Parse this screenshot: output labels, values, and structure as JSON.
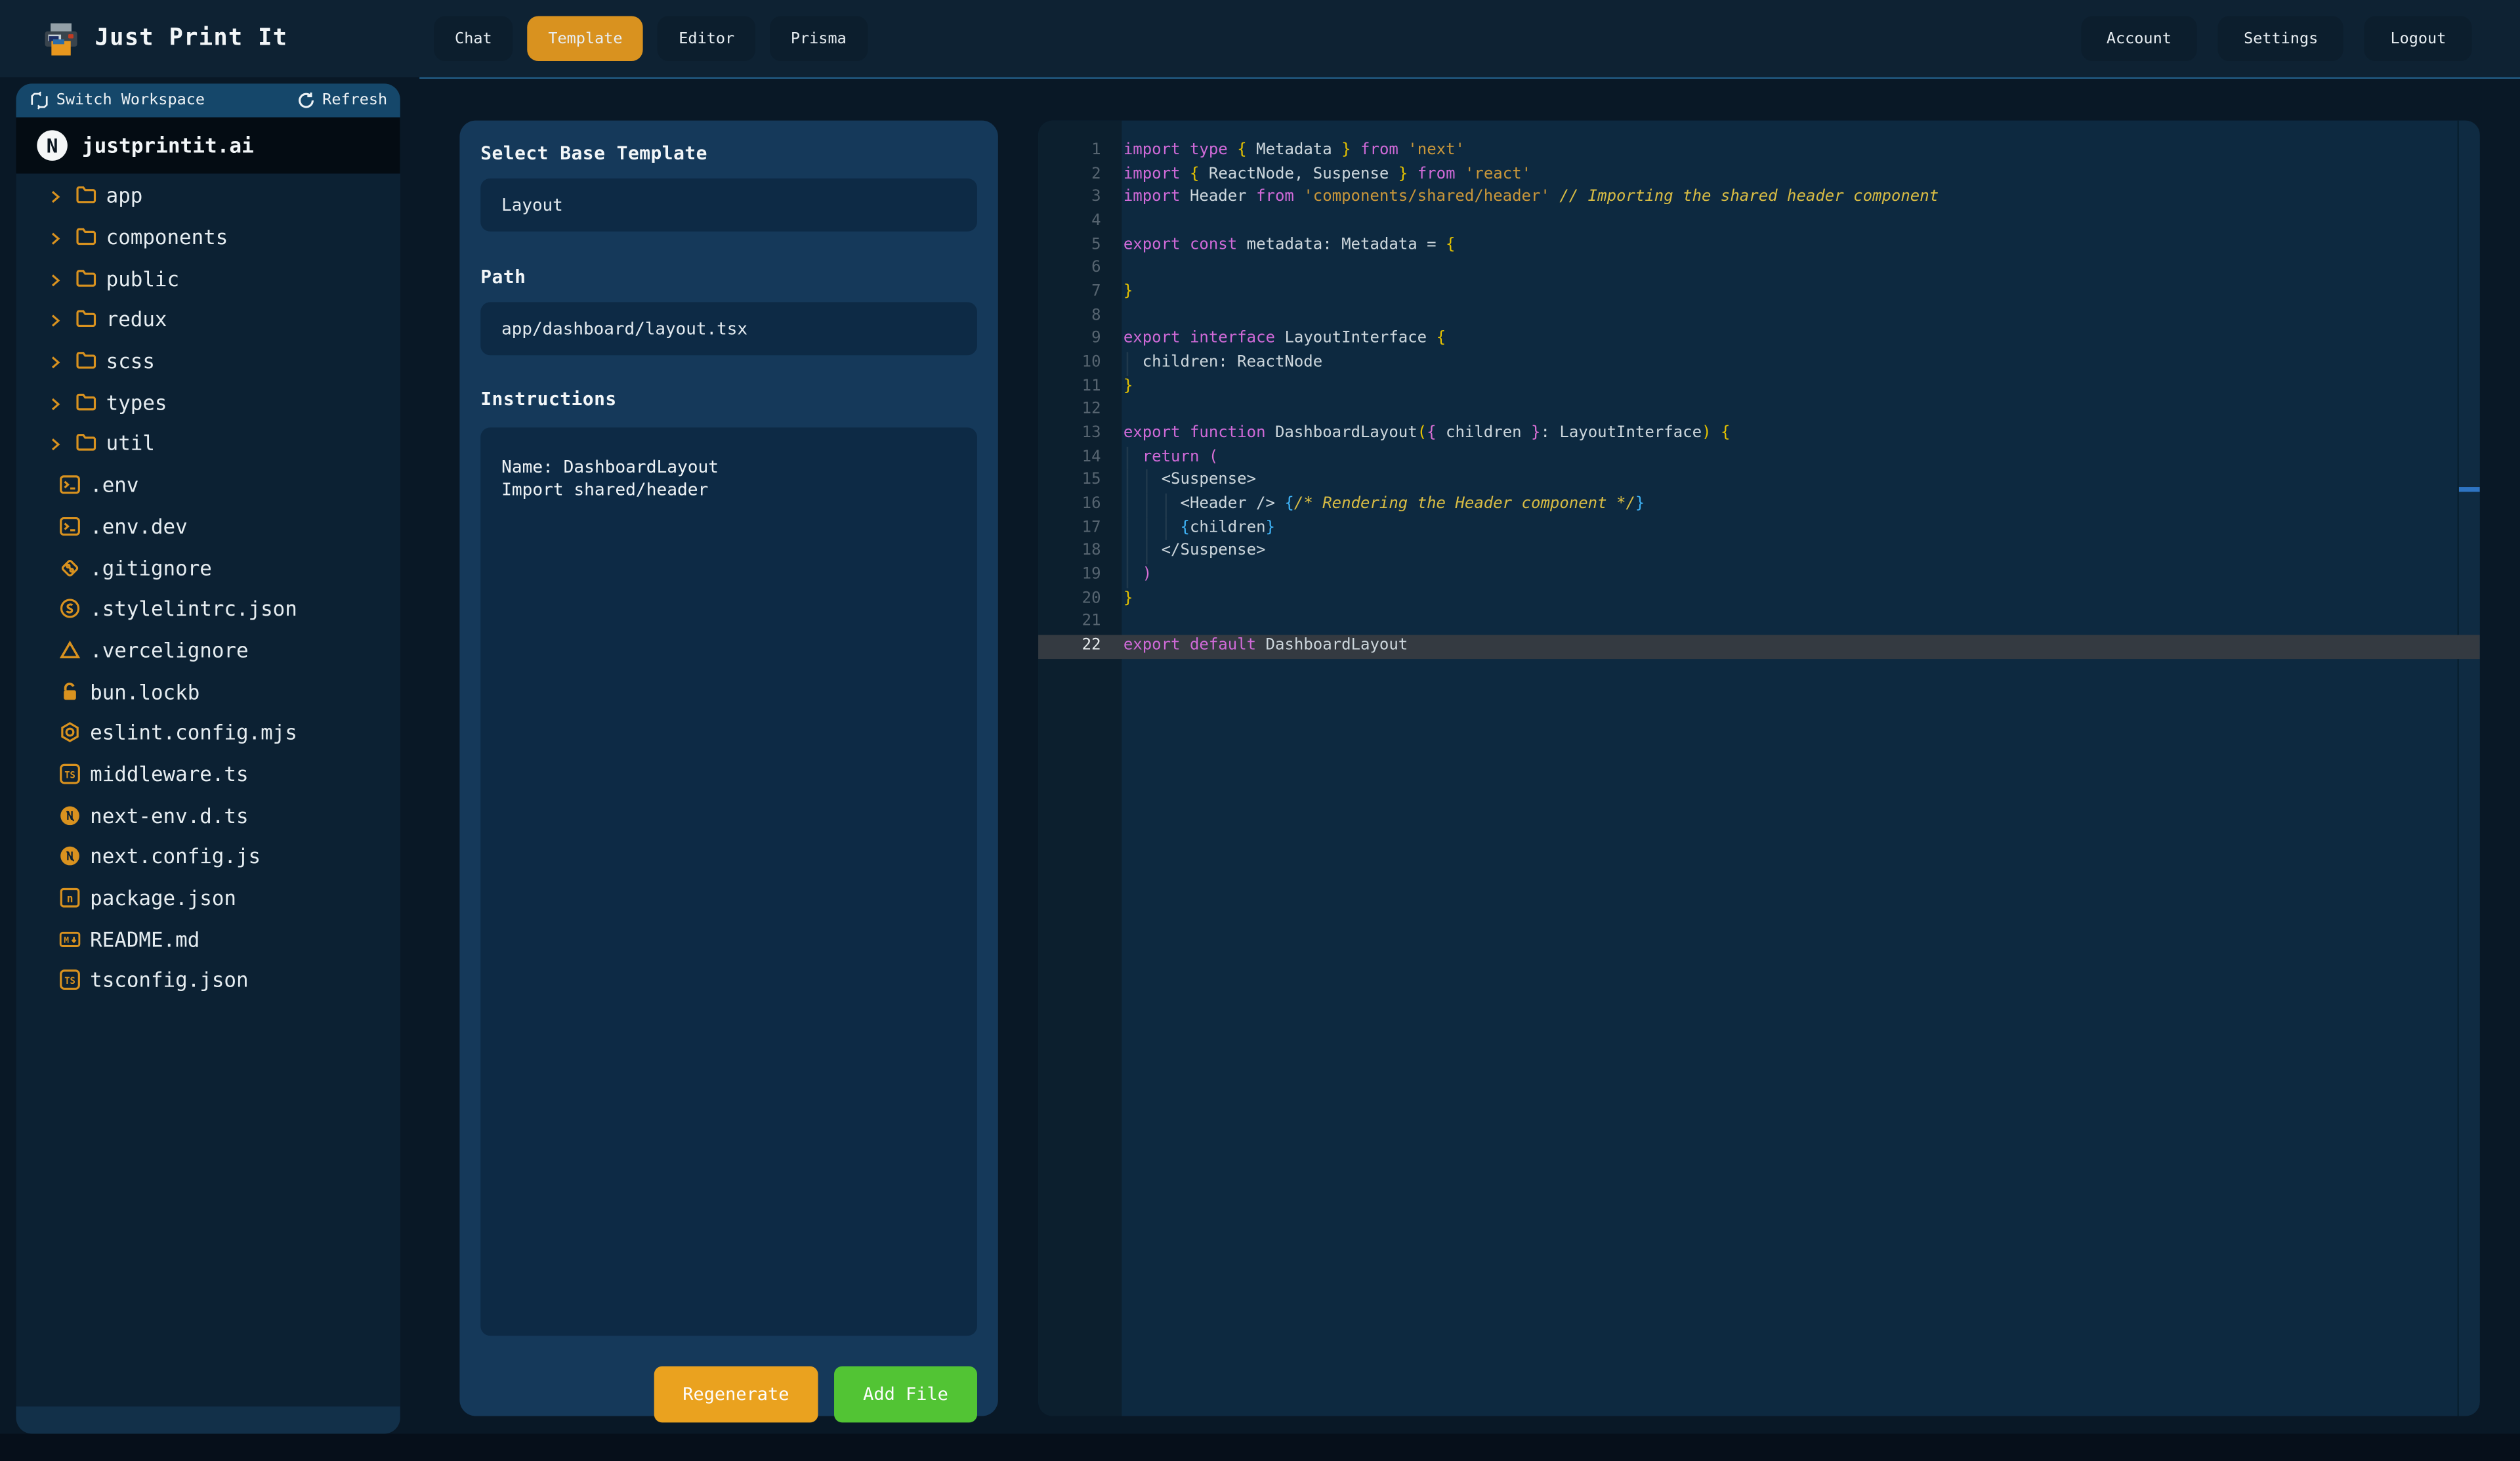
{
  "app": {
    "title": "Just Print It"
  },
  "topbar": {
    "tabs": [
      {
        "label": "Chat",
        "active": false
      },
      {
        "label": "Template",
        "active": true
      },
      {
        "label": "Editor",
        "active": false
      },
      {
        "label": "Prisma",
        "active": false
      }
    ],
    "session_buttons": [
      "Account",
      "Settings",
      "Logout"
    ]
  },
  "sidebar": {
    "switch_workspace_label": "Switch Workspace",
    "refresh_label": "Refresh",
    "workspace_name": "justprintit.ai",
    "workspace_badge": "N",
    "folders": [
      "app",
      "components",
      "public",
      "redux",
      "scss",
      "types",
      "util"
    ],
    "files": [
      {
        "name": ".env",
        "icon": "terminal"
      },
      {
        "name": ".env.dev",
        "icon": "terminal"
      },
      {
        "name": ".gitignore",
        "icon": "git"
      },
      {
        "name": ".stylelintrc.json",
        "icon": "stylelint"
      },
      {
        "name": ".vercelignore",
        "icon": "vercel"
      },
      {
        "name": "bun.lockb",
        "icon": "lock"
      },
      {
        "name": "eslint.config.mjs",
        "icon": "eslint"
      },
      {
        "name": "middleware.ts",
        "icon": "typescript"
      },
      {
        "name": "next-env.d.ts",
        "icon": "nextjs"
      },
      {
        "name": "next.config.js",
        "icon": "nextjs"
      },
      {
        "name": "package.json",
        "icon": "npm"
      },
      {
        "name": "README.md",
        "icon": "markdown"
      },
      {
        "name": "tsconfig.json",
        "icon": "typescript"
      }
    ]
  },
  "template_panel": {
    "base_template_label": "Select Base Template",
    "base_template_value": "Layout",
    "path_label": "Path",
    "path_value": "app/dashboard/layout.tsx",
    "instructions_label": "Instructions",
    "instructions_value": "Name: DashboardLayout\nImport shared/header",
    "regenerate_label": "Regenerate",
    "add_file_label": "Add File"
  },
  "editor": {
    "active_line": 22,
    "lines": [
      {
        "n": 1,
        "indent": 0,
        "tokens": [
          [
            "k",
            "import"
          ],
          [
            "w",
            " "
          ],
          [
            "k",
            "type"
          ],
          [
            "w",
            " "
          ],
          [
            "g",
            "{"
          ],
          [
            "w",
            " Metadata "
          ],
          [
            "g",
            "}"
          ],
          [
            "w",
            " "
          ],
          [
            "k",
            "from"
          ],
          [
            "w",
            " "
          ],
          [
            "s",
            "'next'"
          ]
        ]
      },
      {
        "n": 2,
        "indent": 0,
        "tokens": [
          [
            "k",
            "import"
          ],
          [
            "w",
            " "
          ],
          [
            "g",
            "{"
          ],
          [
            "w",
            " ReactNode, Suspense "
          ],
          [
            "g",
            "}"
          ],
          [
            "w",
            " "
          ],
          [
            "k",
            "from"
          ],
          [
            "w",
            " "
          ],
          [
            "s",
            "'react'"
          ]
        ]
      },
      {
        "n": 3,
        "indent": 0,
        "tokens": [
          [
            "k",
            "import"
          ],
          [
            "w",
            " Header "
          ],
          [
            "k",
            "from"
          ],
          [
            "w",
            " "
          ],
          [
            "s",
            "'components/shared/header'"
          ],
          [
            "w",
            " "
          ],
          [
            "c",
            "// Importing the shared header component"
          ]
        ]
      },
      {
        "n": 4,
        "indent": 0,
        "tokens": []
      },
      {
        "n": 5,
        "indent": 0,
        "tokens": [
          [
            "k",
            "export"
          ],
          [
            "w",
            " "
          ],
          [
            "k",
            "const"
          ],
          [
            "w",
            " metadata: Metadata = "
          ],
          [
            "g",
            "{"
          ]
        ]
      },
      {
        "n": 6,
        "indent": 0,
        "tokens": []
      },
      {
        "n": 7,
        "indent": 0,
        "tokens": [
          [
            "g",
            "}"
          ]
        ]
      },
      {
        "n": 8,
        "indent": 0,
        "tokens": []
      },
      {
        "n": 9,
        "indent": 0,
        "tokens": [
          [
            "k",
            "export"
          ],
          [
            "w",
            " "
          ],
          [
            "k",
            "interface"
          ],
          [
            "w",
            " LayoutInterface "
          ],
          [
            "g",
            "{"
          ]
        ]
      },
      {
        "n": 10,
        "indent": 1,
        "tokens": [
          [
            "w",
            "  children: ReactNode"
          ]
        ]
      },
      {
        "n": 11,
        "indent": 0,
        "tokens": [
          [
            "g",
            "}"
          ]
        ]
      },
      {
        "n": 12,
        "indent": 0,
        "tokens": []
      },
      {
        "n": 13,
        "indent": 0,
        "tokens": [
          [
            "k",
            "export"
          ],
          [
            "w",
            " "
          ],
          [
            "k",
            "function"
          ],
          [
            "w",
            " DashboardLayout"
          ],
          [
            "g",
            "("
          ],
          [
            "p",
            "{"
          ],
          [
            "w",
            " children "
          ],
          [
            "p",
            "}"
          ],
          [
            "w",
            ": LayoutInterface"
          ],
          [
            "g",
            ")"
          ],
          [
            "w",
            " "
          ],
          [
            "g",
            "{"
          ]
        ]
      },
      {
        "n": 14,
        "indent": 1,
        "tokens": [
          [
            "w",
            "  "
          ],
          [
            "k",
            "return"
          ],
          [
            "w",
            " "
          ],
          [
            "p",
            "("
          ]
        ]
      },
      {
        "n": 15,
        "indent": 2,
        "tokens": [
          [
            "w",
            "    <Suspense>"
          ]
        ]
      },
      {
        "n": 16,
        "indent": 3,
        "tokens": [
          [
            "w",
            "      <Header /> "
          ],
          [
            "b",
            "{"
          ],
          [
            "c",
            "/* Rendering the Header component */"
          ],
          [
            "b",
            "}"
          ]
        ]
      },
      {
        "n": 17,
        "indent": 3,
        "tokens": [
          [
            "w",
            "      "
          ],
          [
            "b",
            "{"
          ],
          [
            "w",
            "children"
          ],
          [
            "b",
            "}"
          ]
        ]
      },
      {
        "n": 18,
        "indent": 2,
        "tokens": [
          [
            "w",
            "    </Suspense>"
          ]
        ]
      },
      {
        "n": 19,
        "indent": 1,
        "tokens": [
          [
            "w",
            "  "
          ],
          [
            "p",
            ")"
          ]
        ]
      },
      {
        "n": 20,
        "indent": 0,
        "tokens": [
          [
            "g",
            "}"
          ]
        ]
      },
      {
        "n": 21,
        "indent": 0,
        "tokens": []
      },
      {
        "n": 22,
        "indent": 0,
        "tokens": [
          [
            "k",
            "export"
          ],
          [
            "w",
            " "
          ],
          [
            "k",
            "default"
          ],
          [
            "w",
            " DashboardLayout"
          ]
        ]
      }
    ]
  },
  "colors": {
    "accent_orange": "#d9921f",
    "button_orange": "#eaa21f",
    "button_green": "#52c434",
    "scroll_marker_blue": "#2e74c2",
    "syntax": {
      "k": "#d06ad8",
      "w": "#ccd6dc",
      "g": "#e6c300",
      "p": "#da70d6",
      "b": "#3fb3f6",
      "s": "#c9973a",
      "c": "#d8bc44"
    }
  }
}
